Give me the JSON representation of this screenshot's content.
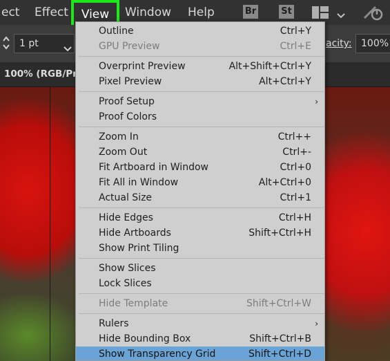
{
  "menubar": {
    "items": [
      {
        "label": "ect"
      },
      {
        "label": "Effect"
      },
      {
        "label": "View"
      },
      {
        "label": "Window"
      },
      {
        "label": "Help"
      }
    ],
    "bridge_badge": "Br",
    "stock_badge": "St"
  },
  "controlbar": {
    "stroke_value": "1 pt",
    "opacity_label": "acity:",
    "opacity_value": "100%"
  },
  "doctab": {
    "label": "100% (RGB/Pr"
  },
  "dropdown": {
    "groups": [
      [
        {
          "label": "Outline",
          "shortcut": "Ctrl+Y",
          "disabled": false
        },
        {
          "label": "GPU Preview",
          "shortcut": "Ctrl+E",
          "disabled": true
        }
      ],
      [
        {
          "label": "Overprint Preview",
          "shortcut": "Alt+Shift+Ctrl+Y",
          "disabled": false
        },
        {
          "label": "Pixel Preview",
          "shortcut": "Alt+Ctrl+Y",
          "disabled": false
        }
      ],
      [
        {
          "label": "Proof Setup",
          "shortcut": "",
          "submenu": true,
          "disabled": false
        },
        {
          "label": "Proof Colors",
          "shortcut": "",
          "disabled": false
        }
      ],
      [
        {
          "label": "Zoom In",
          "shortcut": "Ctrl++",
          "disabled": false
        },
        {
          "label": "Zoom Out",
          "shortcut": "Ctrl+-",
          "disabled": false
        },
        {
          "label": "Fit Artboard in Window",
          "shortcut": "Ctrl+0",
          "disabled": false
        },
        {
          "label": "Fit All in Window",
          "shortcut": "Alt+Ctrl+0",
          "disabled": false
        },
        {
          "label": "Actual Size",
          "shortcut": "Ctrl+1",
          "disabled": false
        }
      ],
      [
        {
          "label": "Hide Edges",
          "shortcut": "Ctrl+H",
          "disabled": false
        },
        {
          "label": "Hide Artboards",
          "shortcut": "Shift+Ctrl+H",
          "disabled": false
        },
        {
          "label": "Show Print Tiling",
          "shortcut": "",
          "disabled": false
        }
      ],
      [
        {
          "label": "Show Slices",
          "shortcut": "",
          "disabled": false
        },
        {
          "label": "Lock Slices",
          "shortcut": "",
          "disabled": false
        }
      ],
      [
        {
          "label": "Hide Template",
          "shortcut": "Shift+Ctrl+W",
          "disabled": true
        }
      ],
      [
        {
          "label": "Rulers",
          "shortcut": "",
          "submenu": true,
          "disabled": false
        },
        {
          "label": "Hide Bounding Box",
          "shortcut": "Shift+Ctrl+B",
          "disabled": false
        },
        {
          "label": "Show Transparency Grid",
          "shortcut": "Shift+Ctrl+D",
          "disabled": false,
          "highlighted": true
        }
      ]
    ]
  },
  "colors": {
    "highlight": "#6aa3d5",
    "focus_outline": "#1ee71a"
  }
}
